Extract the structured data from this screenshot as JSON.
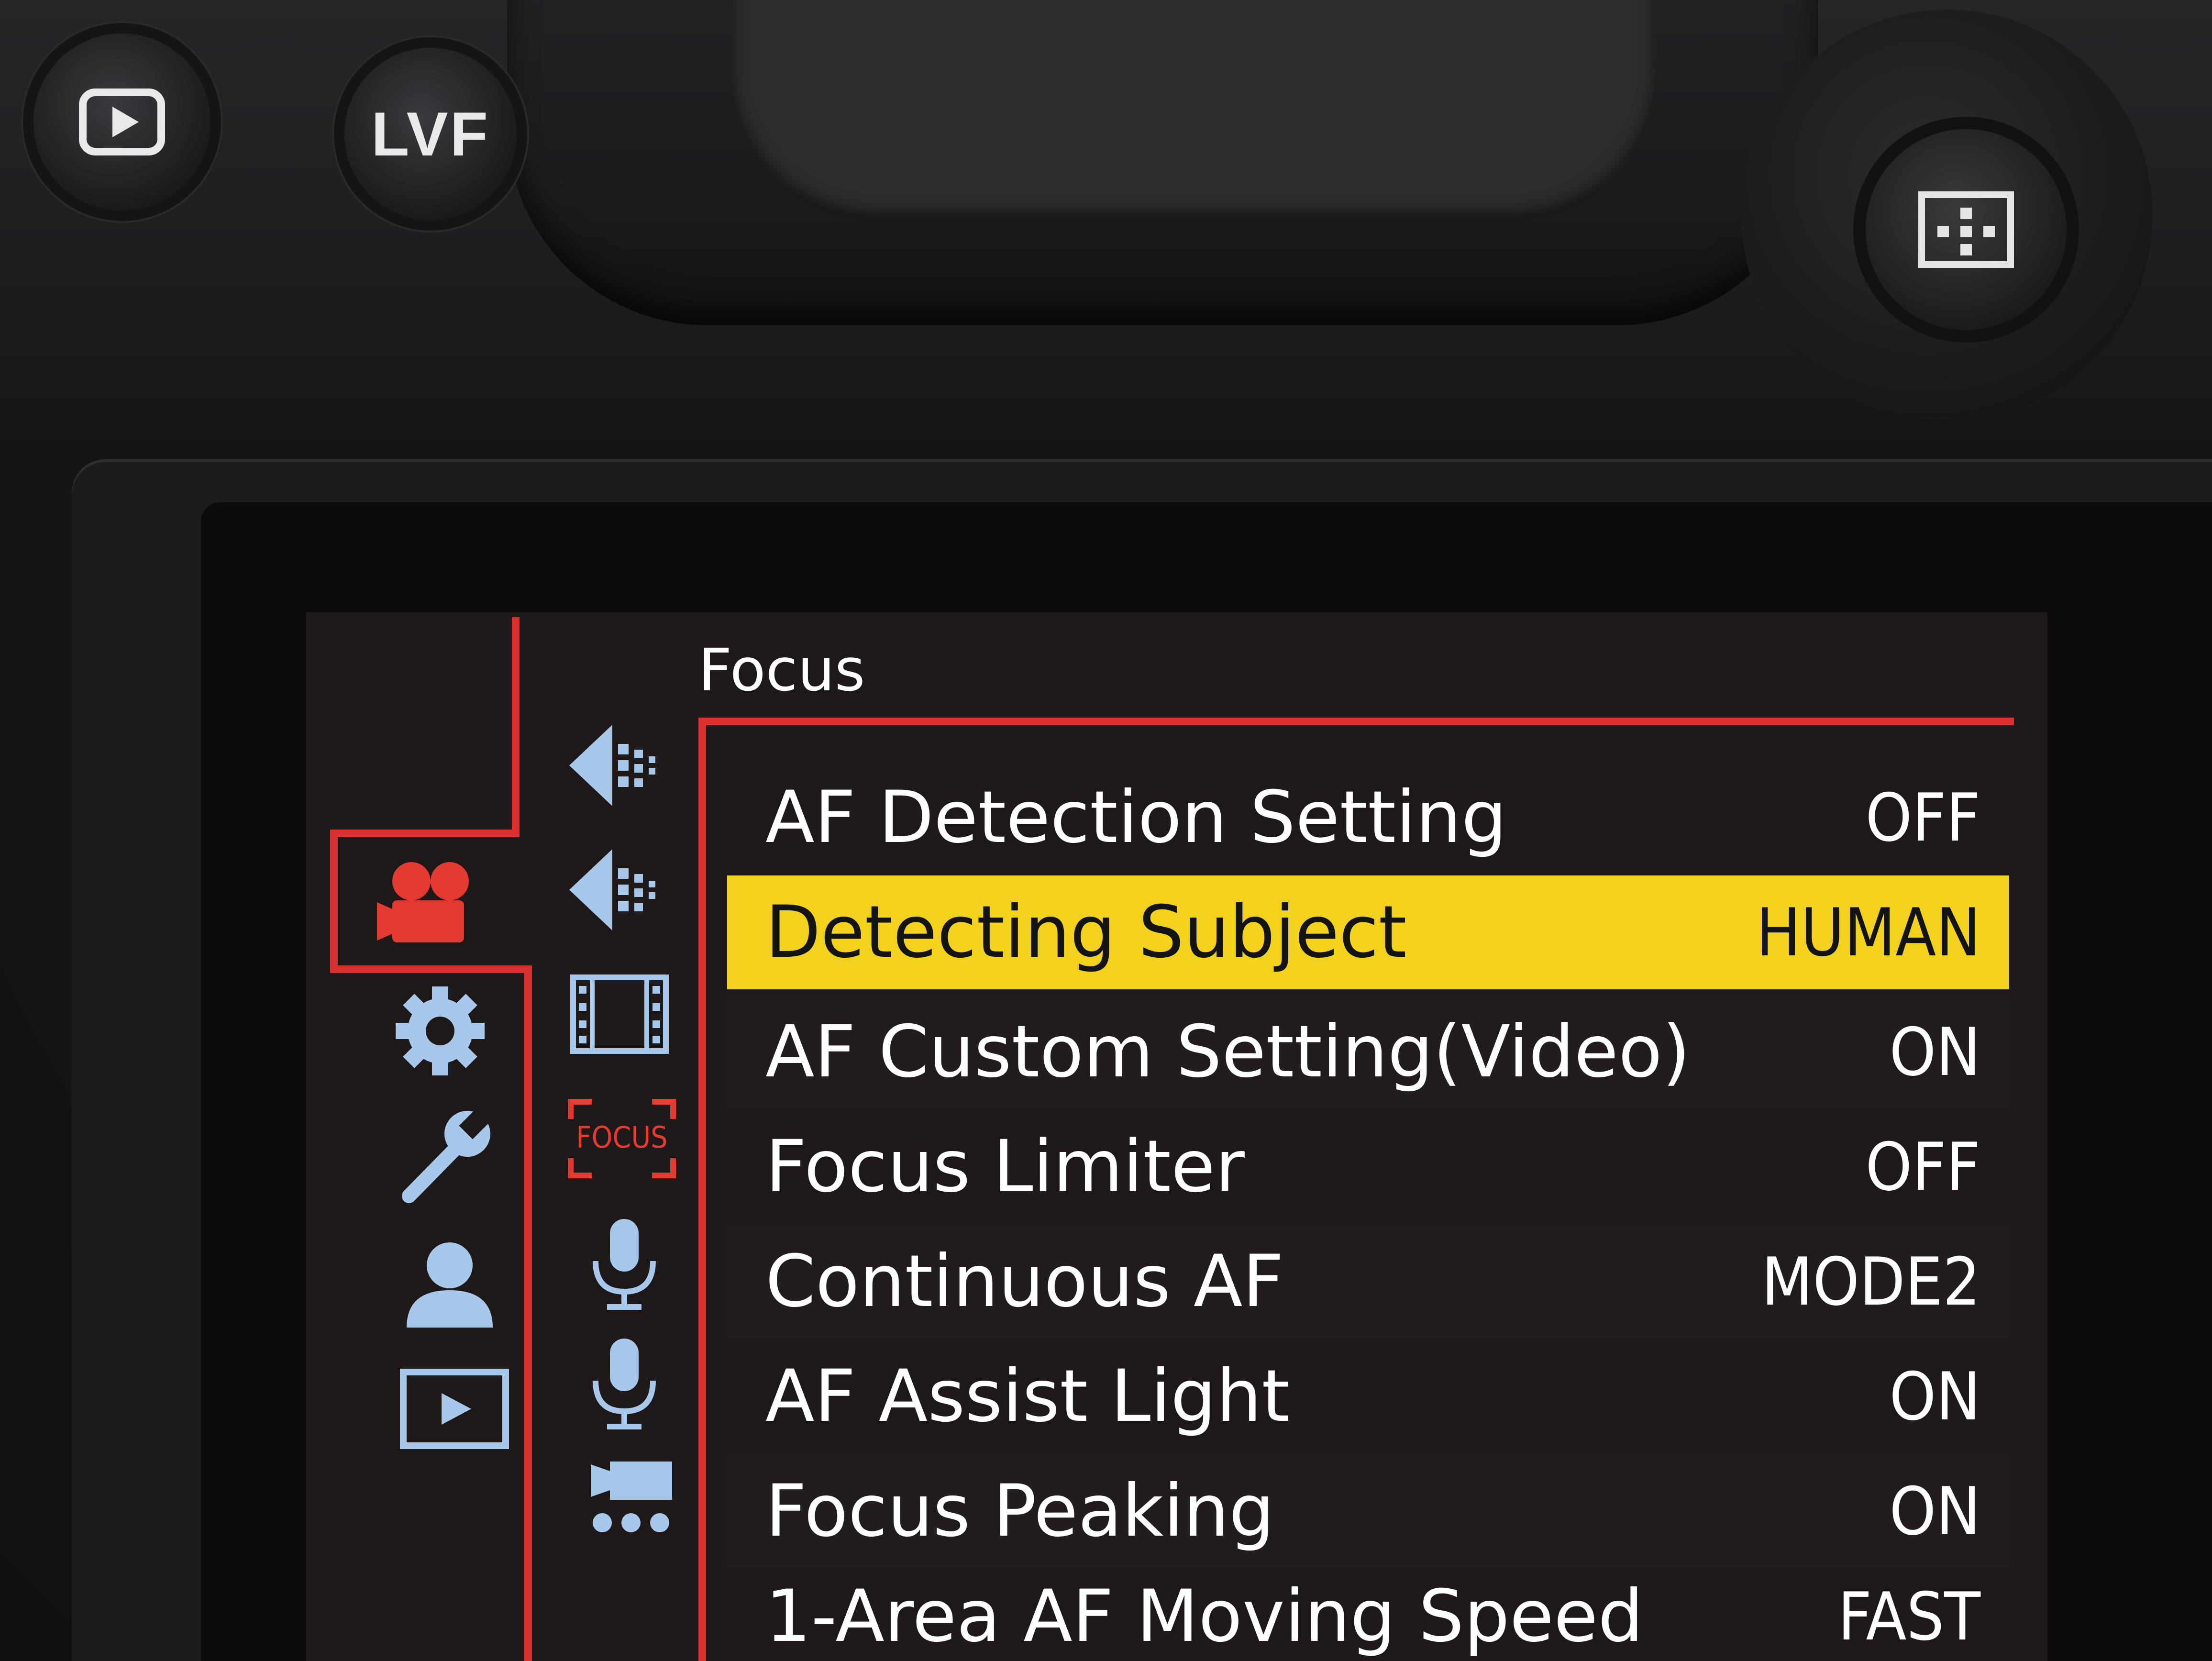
{
  "hardware": {
    "play_button_icon": "play-icon",
    "lvf_button_label": "LVF",
    "joystick_icon": "focus-area-icon"
  },
  "colors": {
    "accent": "#d8312e",
    "highlight": "#f2d21c",
    "sub_icon": "#a7c8ea",
    "text": "#ffffff"
  },
  "main_tabs": [
    {
      "icon": "video-camera-icon",
      "active": true
    },
    {
      "icon": "gear-icon",
      "active": false
    },
    {
      "icon": "wrench-icon",
      "active": false
    },
    {
      "icon": "person-icon",
      "active": false
    },
    {
      "icon": "playback-icon",
      "active": false
    }
  ],
  "sub_tabs": [
    {
      "icon": "exposure-icon-1",
      "active": false
    },
    {
      "icon": "exposure-icon-2",
      "active": false
    },
    {
      "icon": "film-strip-icon",
      "active": false
    },
    {
      "icon": "focus-icon",
      "label": "FOCUS",
      "active": true
    },
    {
      "icon": "microphone-icon-1",
      "active": false
    },
    {
      "icon": "microphone-icon-2",
      "active": false
    },
    {
      "icon": "video-output-icon",
      "active": false
    }
  ],
  "menu": {
    "title": "Focus",
    "items": [
      {
        "label": "AF Detection Setting",
        "value": "OFF"
      },
      {
        "label": "Detecting Subject",
        "value": "HUMAN"
      },
      {
        "label": "AF Custom Setting(Video)",
        "value": "ON"
      },
      {
        "label": "Focus Limiter",
        "value": "OFF"
      },
      {
        "label": "Continuous AF",
        "value": "MODE2"
      },
      {
        "label": "AF Assist Light",
        "value": "ON"
      },
      {
        "label": "Focus Peaking",
        "value": "ON"
      },
      {
        "label": "1-Area AF Moving Speed",
        "value": "FAST"
      }
    ]
  }
}
